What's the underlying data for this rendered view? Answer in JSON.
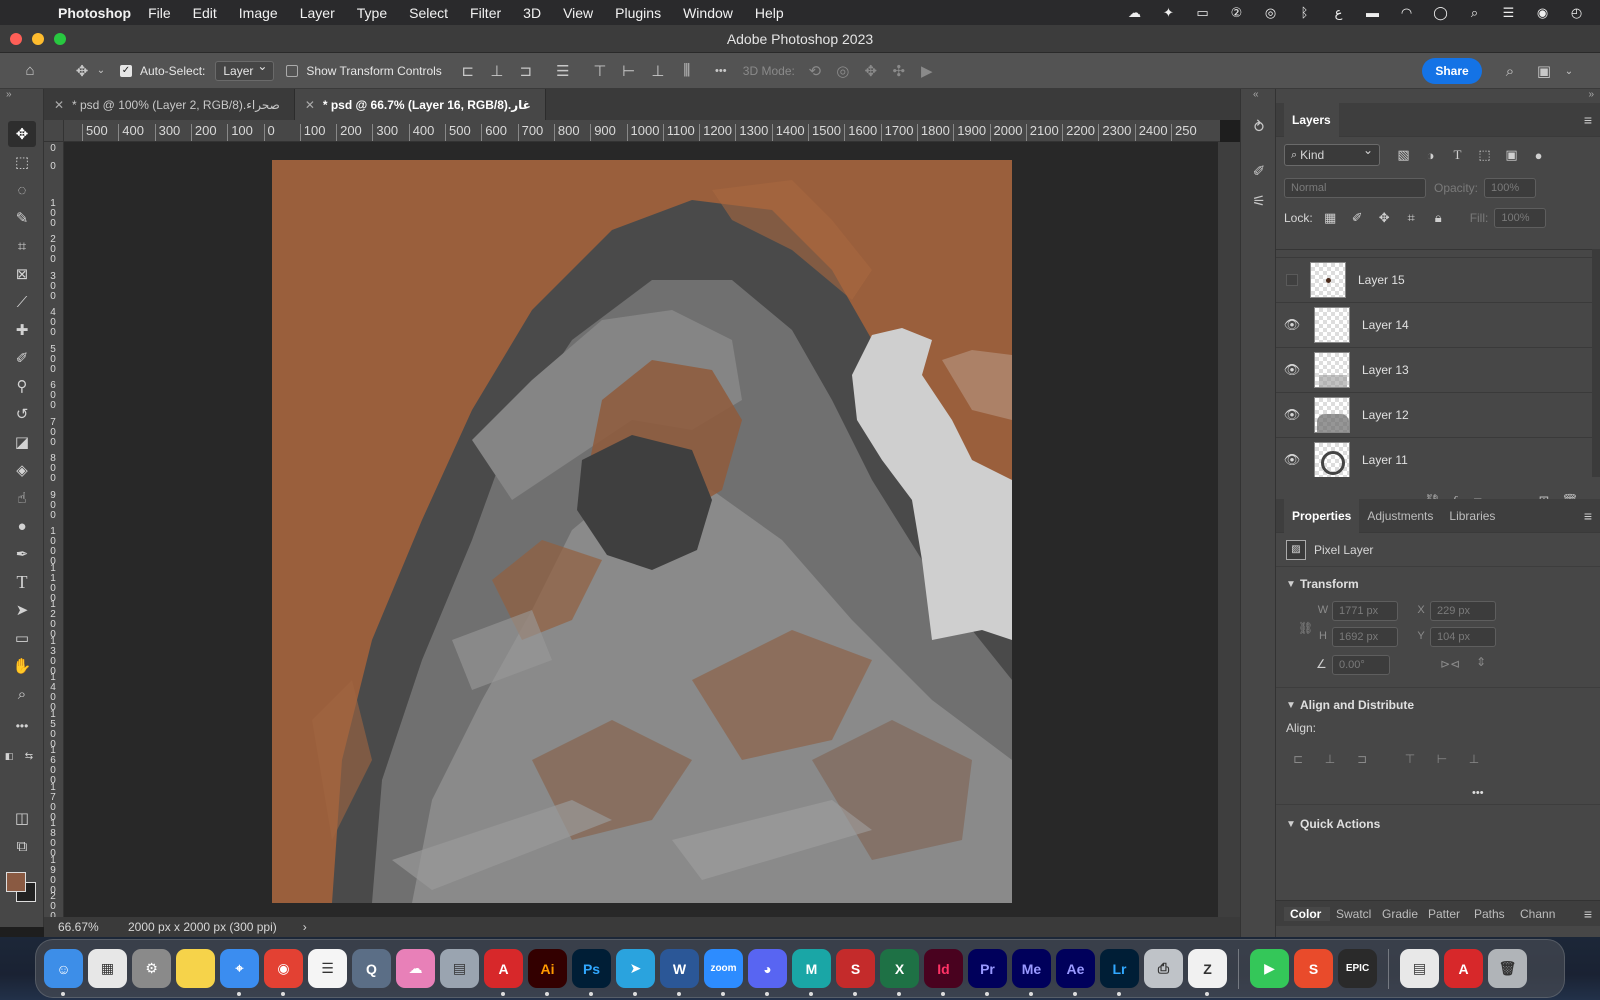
{
  "menubar": {
    "app_name": "Photoshop",
    "items": [
      "File",
      "Edit",
      "Image",
      "Layer",
      "Type",
      "Select",
      "Filter",
      "3D",
      "View",
      "Plugins",
      "Window",
      "Help"
    ]
  },
  "window": {
    "title": "Adobe Photoshop 2023"
  },
  "options": {
    "auto_select_label": "Auto-Select:",
    "auto_select_value": "Layer",
    "show_transform_label": "Show Transform Controls",
    "mode_3d_label": "3D Mode:",
    "share_label": "Share",
    "more_label": "•••"
  },
  "tabs": [
    {
      "label": "* psd @ 100% (Layer 2, RGB/8).صحراء"
    },
    {
      "label": "* psd @ 66.7% (Layer 16, RGB/8).غار"
    }
  ],
  "ruler": {
    "h_labels": [
      "500",
      "400",
      "300",
      "200",
      "100",
      "0",
      "100",
      "200",
      "300",
      "400",
      "500",
      "600",
      "700",
      "800",
      "900",
      "1000",
      "1100",
      "1200",
      "1300",
      "1400",
      "1500",
      "1600",
      "1700",
      "1800",
      "1900",
      "2000",
      "2100",
      "2200",
      "2300",
      "2400",
      "250"
    ],
    "v_labels": [
      "0",
      "0",
      "1 0 0",
      "2 0 0",
      "3 0 0",
      "4 0 0",
      "5 0 0",
      "6 0 0",
      "7 0 0",
      "8 0 0",
      "9 0 0",
      "1 0 0 0",
      "1 1 0 0",
      "1 2 0 0",
      "1 3 0 0",
      "1 4 0 0",
      "1 5 0 0",
      "1 6 0 0",
      "1 7 0 0",
      "1 8 0 0",
      "1 9 0 0",
      "2 0 0"
    ]
  },
  "status": {
    "zoom": "66.67%",
    "doc_info": "2000 px x 2000 px (300 ppi)",
    "arrow": "›"
  },
  "layers_panel": {
    "title": "Layers",
    "kind_label": "Kind",
    "blend_mode": "Normal",
    "opacity_label": "Opacity:",
    "opacity_value": "100%",
    "lock_label": "Lock:",
    "fill_label": "Fill:",
    "fill_value": "100%",
    "layers": [
      {
        "name": "Layer 15",
        "visible": false
      },
      {
        "name": "Layer 14",
        "visible": true
      },
      {
        "name": "Layer 13",
        "visible": true
      },
      {
        "name": "Layer 12",
        "visible": true
      },
      {
        "name": "Layer 11",
        "visible": true
      }
    ]
  },
  "properties_panel": {
    "tabs": [
      "Properties",
      "Adjustments",
      "Libraries"
    ],
    "layer_type": "Pixel Layer",
    "transform_label": "Transform",
    "w_label": "W",
    "w_value": "1771 px",
    "h_label": "H",
    "h_value": "1692 px",
    "x_label": "X",
    "x_value": "229 px",
    "y_label": "Y",
    "y_value": "104 px",
    "angle_value": "0.00°",
    "align_section": "Align and Distribute",
    "align_label": "Align:",
    "quick_actions": "Quick Actions",
    "more": "•••"
  },
  "bottom_tabs": [
    "Color",
    "Swatches",
    "Gradients",
    "Patterns",
    "Paths",
    "Channels"
  ],
  "bottom_tabs_display": [
    "Color",
    "Swatcl",
    "Gradie",
    "Patter",
    "Paths",
    "Chann"
  ],
  "dock": [
    {
      "name": "Finder",
      "label": "☺",
      "color": "#3d8ee8"
    },
    {
      "name": "Launchpad",
      "label": "▦",
      "color": "#e7e7e7"
    },
    {
      "name": "System Settings",
      "label": "⚙",
      "color": "#8a8a8a"
    },
    {
      "name": "Notes",
      "label": "",
      "color": "#f6d34a"
    },
    {
      "name": "Safari",
      "label": "⌖",
      "color": "#3b8df0"
    },
    {
      "name": "Chrome",
      "label": "◉",
      "color": "#e34133"
    },
    {
      "name": "Reminders",
      "label": "☰",
      "color": "#f5f5f5"
    },
    {
      "name": "QuickTime",
      "label": "Q",
      "color": "#5b6e86"
    },
    {
      "name": "Creative Cloud",
      "label": "☁",
      "color": "#e880b8"
    },
    {
      "name": "Preview",
      "label": "▤",
      "color": "#9aa4b0"
    },
    {
      "name": "Acrobat",
      "label": "A",
      "color": "#d7282a"
    },
    {
      "name": "Illustrator",
      "label": "Ai",
      "color": "#330000"
    },
    {
      "name": "Photoshop",
      "label": "Ps",
      "color": "#001e36"
    },
    {
      "name": "Telegram",
      "label": "➤",
      "color": "#2aa3de"
    },
    {
      "name": "Word",
      "label": "W",
      "color": "#2b5797"
    },
    {
      "name": "Zoom",
      "label": "zoom",
      "color": "#2d8cff"
    },
    {
      "name": "Discord",
      "label": "◕",
      "color": "#5865f2"
    },
    {
      "name": "Maya",
      "label": "M",
      "color": "#1aa6a6"
    },
    {
      "name": "SketchUp",
      "label": "S",
      "color": "#c42b2b"
    },
    {
      "name": "Excel",
      "label": "X",
      "color": "#1e7145"
    },
    {
      "name": "InDesign",
      "label": "Id",
      "color": "#49021f"
    },
    {
      "name": "Premiere Pro",
      "label": "Pr",
      "color": "#00005b"
    },
    {
      "name": "Media Encoder",
      "label": "Me",
      "color": "#00005b"
    },
    {
      "name": "After Effects",
      "label": "Ae",
      "color": "#00005b"
    },
    {
      "name": "Lightroom",
      "label": "Lr",
      "color": "#001e36"
    },
    {
      "name": "Printer",
      "label": "⎙",
      "color": "#bfc3c8"
    },
    {
      "name": "ZBrush",
      "label": "Z",
      "color": "#f1f1f1"
    },
    {
      "name": "FaceTime",
      "label": "▶",
      "color": "#34c759"
    },
    {
      "name": "Substance",
      "label": "S",
      "color": "#e94b2b"
    },
    {
      "name": "Epic Games",
      "label": "EPIC",
      "color": "#2a2a2a"
    },
    {
      "name": "Documents",
      "label": "▤",
      "color": "#e8e8e8"
    },
    {
      "name": "Acrobat PDF",
      "label": "A",
      "color": "#d7282a"
    },
    {
      "name": "Trash",
      "label": "🗑",
      "color": "#b0b4b8"
    }
  ],
  "colors": {
    "accent": "#1473e6",
    "canvas_bg": "#9a5f3c",
    "foreground": "#8a5a42"
  }
}
